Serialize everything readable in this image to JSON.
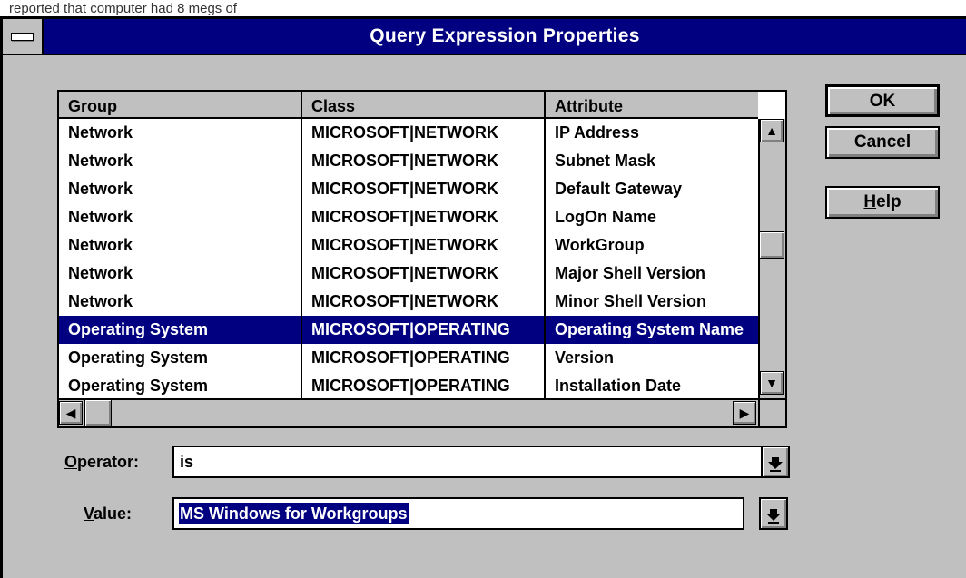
{
  "caption": "reported that computer had 8 megs of",
  "window": {
    "title": "Query Expression Properties"
  },
  "list": {
    "columns": [
      "Group",
      "Class",
      "Attribute"
    ],
    "rows": [
      {
        "group": "Network",
        "class": "MICROSOFT|NETWORK",
        "attribute": "IP Address"
      },
      {
        "group": "Network",
        "class": "MICROSOFT|NETWORK",
        "attribute": "Subnet Mask"
      },
      {
        "group": "Network",
        "class": "MICROSOFT|NETWORK",
        "attribute": "Default Gateway"
      },
      {
        "group": "Network",
        "class": "MICROSOFT|NETWORK",
        "attribute": "LogOn Name"
      },
      {
        "group": "Network",
        "class": "MICROSOFT|NETWORK",
        "attribute": "WorkGroup"
      },
      {
        "group": "Network",
        "class": "MICROSOFT|NETWORK",
        "attribute": "Major Shell Version"
      },
      {
        "group": "Network",
        "class": "MICROSOFT|NETWORK",
        "attribute": "Minor Shell Version"
      },
      {
        "group": "Operating System",
        "class": "MICROSOFT|OPERATING",
        "attribute": "Operating System Name",
        "selected": true
      },
      {
        "group": "Operating System",
        "class": "MICROSOFT|OPERATING",
        "attribute": "Version"
      },
      {
        "group": "Operating System",
        "class": "MICROSOFT|OPERATING",
        "attribute": "Installation Date"
      }
    ]
  },
  "buttons": {
    "ok": "OK",
    "cancel": "Cancel",
    "help_prefix": "",
    "help_mnemonic": "H",
    "help_rest": "elp"
  },
  "operator": {
    "label_mnemonic": "O",
    "label_rest": "perator:",
    "value": "is"
  },
  "value": {
    "label_mnemonic": "V",
    "label_rest": "alue:",
    "value": "MS Windows for Workgroups"
  },
  "icons": {
    "up": "up-arrow-icon",
    "down": "down-arrow-icon",
    "left": "left-arrow-icon",
    "right": "right-arrow-icon",
    "dropdown": "dropdown-arrow-icon"
  },
  "colors": {
    "titlebar": "#000080",
    "selection": "#000080",
    "face": "#c0c0c0"
  }
}
